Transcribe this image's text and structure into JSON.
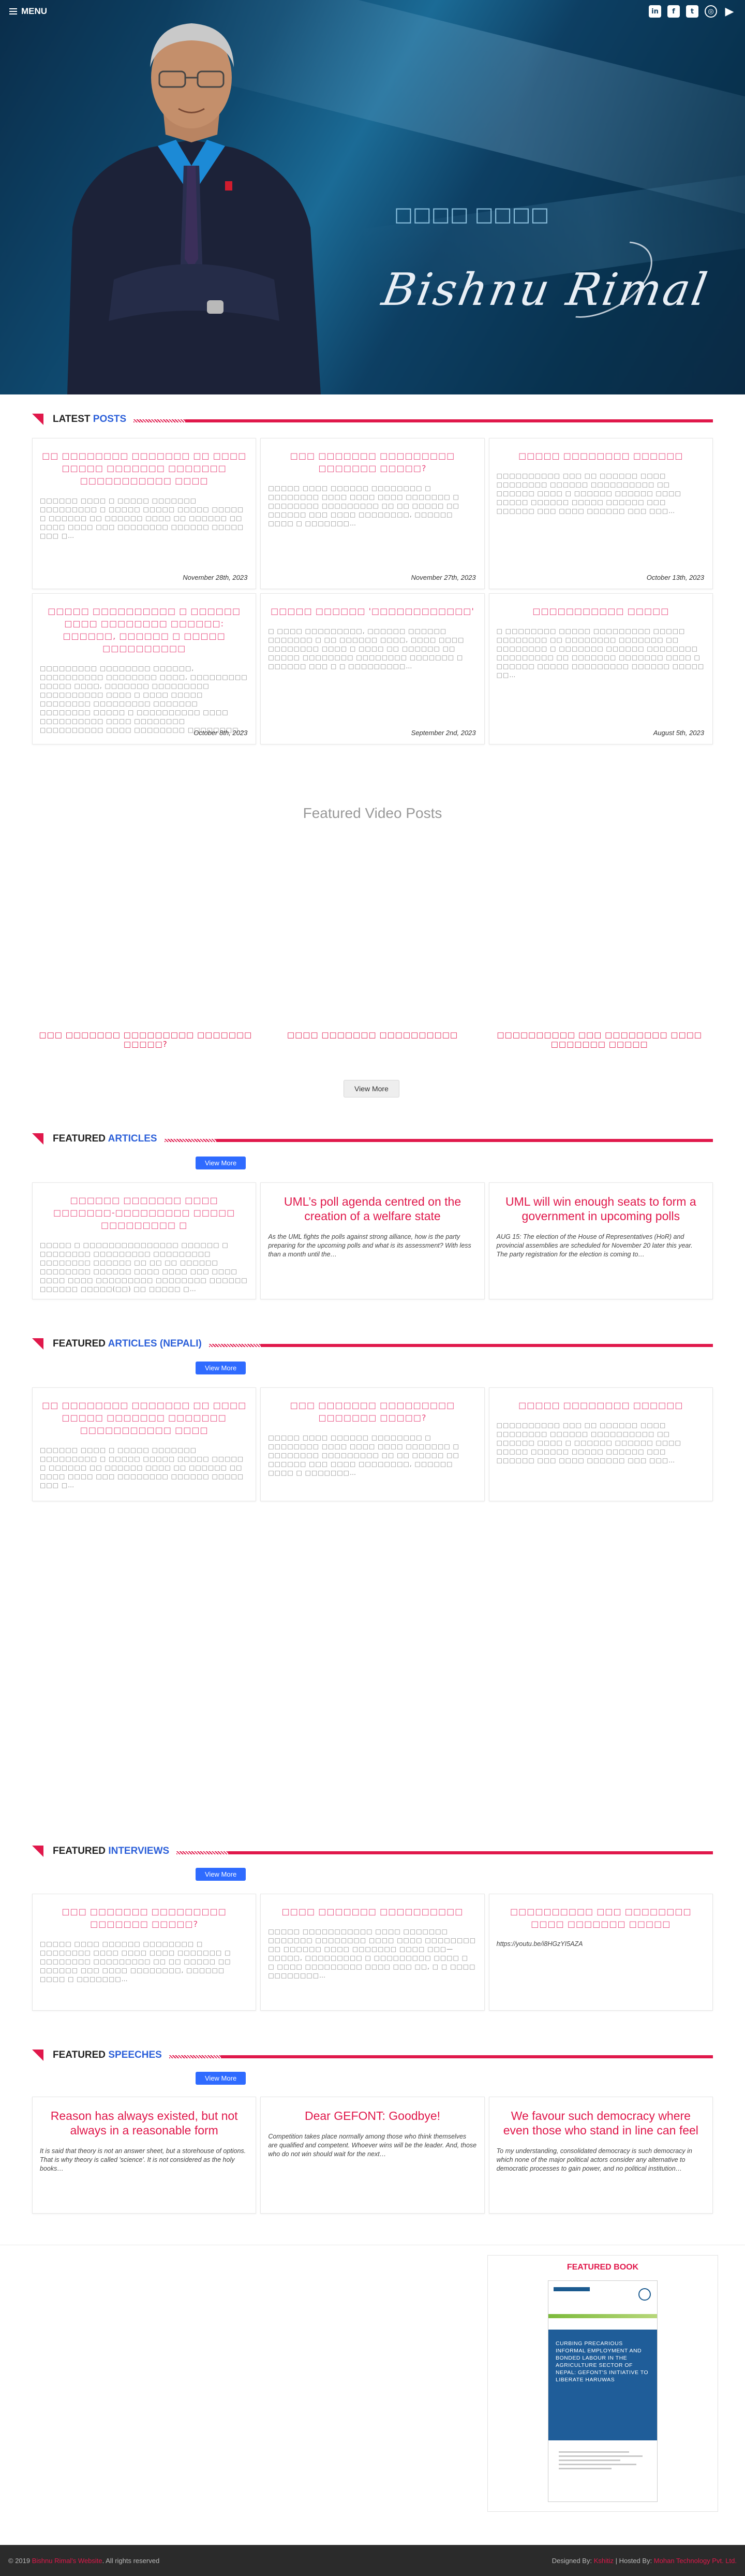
{
  "header": {
    "menu_label": "MENU",
    "social_icons": [
      "linkedin-icon",
      "facebook-icon",
      "twitter-icon",
      "instagram-icon",
      "youtube-icon"
    ],
    "signature_nepali": "□□□□ □□□□",
    "signature": "Bishnu Rimal"
  },
  "latest_posts": {
    "heading_a": "LATEST ",
    "heading_b": "POSTS",
    "posts": [
      {
        "title": "□□ □□□□□□□□ □□□□□□□ □□ □□□□ □□□□□ □□□□□□□ □□□□□□□ □□□□□□□□□□□ □□□□",
        "excerpt": "□□□□□□ □□□□ □ □□□□□ □□□□□□□ □□□□□□□□□ □ □□□□□ □□□□□ □□□□□ □□□□□ □ □□□□□□ □□ □□□□□□ □□□□ □□ □□□□□□ □□ □□□□ □□□□ □□□ □□□□□□□□ □□□□□□ □□□□□ □□□ □…",
        "date": "November 28th, 2023"
      },
      {
        "title": "□□□ □□□□□□□ □□□□□□□□□ □□□□□□□ □□□□□?",
        "excerpt": "□□□□□ □□□□ □□□□□□ □□□□□□□□ □ □□□□□□□□ □□□□ □□□□ □□□□ □□□□□□□ □ □□□□□□□□ □□□□□□□□□ □□ □□ □□□□□ □□ □□□□□□ □□□ □□□□ □□□□□□□□, □□□□□□ □□□□ □ □□□□□□□…",
        "date": "November 27th, 2023"
      },
      {
        "title": "□□□□□ □□□□□□□□ □□□□□□",
        "excerpt": "□□□□□□□□□□ □□□ □□ □□□□□□ □□□□ □□□□□□□□ □□□□□□ □□□□□□□□□□ □□ □□□□□□ □□□□ □ □□□□□□ □□□□□□ □□□□ □□□□□ □□□□□□ □□□□□ □□□□□□ □□□ □□□□□□ □□□ □□□□ □□□□□□ □□□ □□□…",
        "date": "October 13th, 2023"
      },
      {
        "title": "□□□□□ □□□□□□□□□□ □ □□□□□□ □□□□ □□□□□□□□ □□□□□□: □□□□□□, □□□□□□ □ □□□□□ □□□□□□□□□□",
        "excerpt": "□□□□□□□□□ □□□□□□□□ □□□□□□, □□□□□□□□□□ □□□□□□□□ □□□□, □□□□□□□□□ □□□□□ □□□□, □□□□□□□ □□□□□□□□□ □□□□□□□□□□ □□□□ □ □□□□ □□□□□ □□□□□□□□ □□□□□□□□□ □□□□□□□ □□□□□□□□ □□□□□ □ □□□□□□□□□□ □□□□ □□□□□□□□□□ □□□□ □□□□□□□□ □□□□□□□□□□ □□□□ □□□□□□□□ □□□□□□□□…",
        "date": "October 8th, 2023"
      },
      {
        "title": "□□□□□ □□□□□□ '□□□□□□□□□□□□'",
        "excerpt": "□ □□□□ □□□□□□□□□, □□□□□□ □□□□□□ □□□□□□□ □ □□ □□□□□□ □□□□, □□□□ □□□□ □□□□□□□□ □□□□ □ □□□□ □□ □□□□□□ □□ □□□□□ □□□□□□□□ □□□□□□□□ □□□□□□□ □ □□□□□□ □□□ □ □ □□□□□□□□□…",
        "date": "September 2nd, 2023"
      },
      {
        "title": "□□□□□□□□□□□ □□□□□",
        "excerpt": "□ □□□□□□□□ □□□□□ □□□□□□□□□ □□□□□ □□□□□□□□ □□ □□□□□□□□ □□□□□□□ □□ □□□□□□□□ □ □□□□□□□ □□□□□□ □□□□□□□□ □□□□□□□□□ □□ □□□□□□□ □□□□□□□ □□□□ □ □□□□□□ □□□□□ □□□□□□□□□ □□□□□□ □□□□□ □□…",
        "date": "August 5th, 2023"
      }
    ]
  },
  "featured_video": {
    "heading": "Featured Video Posts",
    "videos": [
      {
        "title": "□□□ □□□□□□□ □□□□□□□□□ □□□□□□□ □□□□□?"
      },
      {
        "title": "□□□□ □□□□□□□ □□□□□□□□□□"
      },
      {
        "title": "□□□□□□□□□□ □□□ □□□□□□□□ □□□□ □□□□□□□ □□□□□"
      }
    ],
    "view_more": "View More"
  },
  "featured_articles": {
    "heading_a": "FEATURED ",
    "heading_b": "ARTICLES",
    "view_more": "View More",
    "articles": [
      {
        "title": "□□□□□□ □□□□□□□ □□□□ □□□□□□□-□□□□□□□□□ □□□□□ □□□□□□□□□ □",
        "title_style": "np",
        "excerpt": "□□□□□ □ □□□□□□□□□□□□□□□ □□□□□□ □ □□□□□□□□ □□□□□□□□□ □□□□□□□□□ □□□□□□□□ □□□□□□ □□ □□ □□ □□□□□□ □□□□□□□□ □□□□□□ □□□□ □□□□ □□□ □□□□ □□□□ □□□□ □□□□□□□□□ □□□□□□□□ □□□□□□ □□□□□□ □□□□□(□□) □□ □□□□□ □…",
        "excerpt_style": "np"
      },
      {
        "title": "UML’s poll agenda centred on the creation of a welfare state",
        "title_style": "en",
        "excerpt": "As the UML fights the polls against strong alliance, how is the party preparing for the upcoming polls and what is its assessment? With less than a month until the…",
        "excerpt_style": "en"
      },
      {
        "title": "UML will win enough seats to form a government in upcoming polls",
        "title_style": "en",
        "excerpt": "AUG 15: The election of the House of Representatives (HoR) and provincial assemblies are scheduled for November 20 later this year. The party registration for the election is coming to…",
        "excerpt_style": "en"
      }
    ]
  },
  "featured_articles_nepali": {
    "heading_a": "FEATURED ",
    "heading_b": "ARTICLES (NEPALI)",
    "view_more": "View More",
    "articles": [
      {
        "title": "□□ □□□□□□□□ □□□□□□□ □□ □□□□ □□□□□ □□□□□□□ □□□□□□□ □□□□□□□□□□□ □□□□",
        "excerpt": "□□□□□□ □□□□ □ □□□□□ □□□□□□□ □□□□□□□□□ □ □□□□□ □□□□□ □□□□□ □□□□□ □ □□□□□□ □□ □□□□□□ □□□□ □□ □□□□□□ □□ □□□□ □□□□ □□□ □□□□□□□□ □□□□□□ □□□□□ □□□ □…"
      },
      {
        "title": "□□□ □□□□□□□ □□□□□□□□□ □□□□□□□ □□□□□?",
        "excerpt": "□□□□□ □□□□ □□□□□□ □□□□□□□□ □ □□□□□□□□ □□□□ □□□□ □□□□ □□□□□□□ □ □□□□□□□□ □□□□□□□□□ □□ □□ □□□□□ □□ □□□□□□ □□□ □□□□ □□□□□□□□, □□□□□□ □□□□ □ □□□□□□□…"
      },
      {
        "title": "□□□□□ □□□□□□□□ □□□□□□",
        "excerpt": "□□□□□□□□□□ □□□ □□ □□□□□□ □□□□ □□□□□□□□ □□□□□□ □□□□□□□□□□ □□ □□□□□□ □□□□ □ □□□□□□ □□□□□□ □□□□ □□□□□ □□□□□□ □□□□□ □□□□□□ □□□ □□□□□□ □□□ □□□□ □□□□□□ □□□ □□□…"
      }
    ]
  },
  "featured_interviews": {
    "heading_a": "FEATURED ",
    "heading_b": "INTERVIEWS",
    "view_more": "View More",
    "interviews": [
      {
        "title": "□□□ □□□□□□□ □□□□□□□□□ □□□□□□□ □□□□□?",
        "excerpt": "□□□□□ □□□□ □□□□□□ □□□□□□□□ □ □□□□□□□□ □□□□ □□□□ □□□□ □□□□□□□ □ □□□□□□□□ □□□□□□□□□ □□ □□ □□□□□ □□ □□□□□□ □□□ □□□□ □□□□□□□□, □□□□□□ □□□□ □ □□□□□□□…"
      },
      {
        "title": "□□□□ □□□□□□□ □□□□□□□□□□",
        "excerpt": "□□□□□ □□□□□□□□□□□ □□□□ □□□□□□□ □□□□□□□ □□□□□□□□ □□□□ □□□□ □□□□□□□□ □□ □□□□□□ □□□□ □□□□□□□ □□□□ □□□— □□□□□, □□□□□□□□□ □ □□□□□□□□□ □□□□ □ □ □□□□ □□□□□□□□□ □□□□ □□□ □□, □ □ □□□□ □□□□□□□□…"
      },
      {
        "title": "□□□□□□□□□□ □□□ □□□□□□□□ □□□□ □□□□□□□ □□□□□",
        "excerpt": "https://youtu.be/i8HGzYI5AZA"
      }
    ]
  },
  "featured_speeches": {
    "heading_a": "FEATURED ",
    "heading_b": "SPEECHES",
    "view_more": "View More",
    "speeches": [
      {
        "title": "Reason has always existed, but not always in a reasonable form",
        "excerpt": "It is said that theory is not an answer sheet, but a storehouse of options. That is why theory is called 'science'. It is not considered as the holy books…"
      },
      {
        "title": "Dear GEFONT: Goodbye!",
        "excerpt": "Competition takes place normally among those who think themselves are qualified and competent. Whoever wins will be the leader. And, those who do not win should wait for the next…"
      },
      {
        "title": "We favour such democracy where even those who stand in line can feel",
        "excerpt": "To my understanding, consolidated democracy is such democracy in which none of the major political actors consider any alternative to democratic processes to gain power, and no political institution…"
      }
    ]
  },
  "featured_book": {
    "heading": "FEATURED BOOK",
    "cover_title": "CURBING PRECARIOUS INFORMAL EMPLOYMENT AND BONDED LABOUR IN THE AGRICULTURE SECTOR OF NEPAL: GEFONT'S INITIATIVE TO LIBERATE HARUWAS"
  },
  "footer": {
    "copyright_a": "© 2019 ",
    "copyright_brand": "Bishnu Rimal's Website",
    "copyright_b": ". All rights reserved",
    "credits_a": "Designed By: ",
    "designer": "Kshitiz",
    "credits_sep": " | Hosted By: ",
    "host": "Mohan Technology Pvt. Ltd."
  },
  "colors": {
    "accent": "#e0184b",
    "button_blue": "#2f6bff",
    "heading_blue": "#2b5fd9",
    "hero_blue": "#0f4a70",
    "footer_bg": "#2b2b2b"
  }
}
